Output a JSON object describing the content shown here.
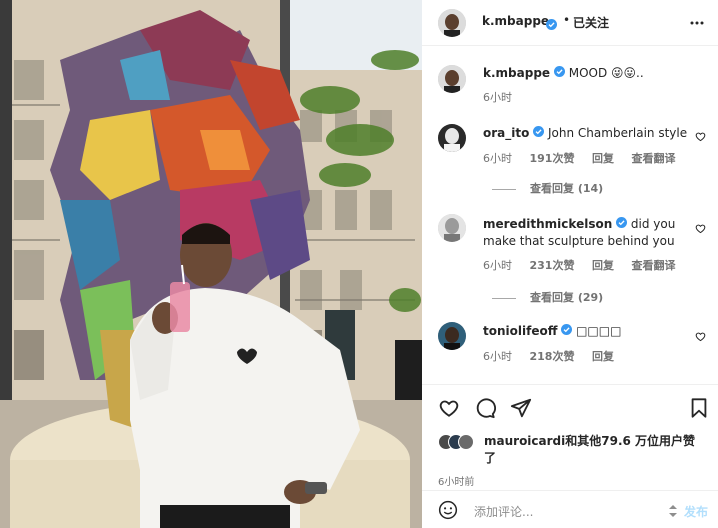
{
  "header": {
    "username": "k.mbappe",
    "separator": "•",
    "follow_status": "已关注",
    "more_icon": "more-horizontal-icon"
  },
  "caption": {
    "username": "k.mbappe",
    "text": "MOOD 😜😛..",
    "time": "6小时"
  },
  "comments": [
    {
      "username": "ora_ito",
      "verified": true,
      "text": "John Chamberlain style",
      "time": "6小时",
      "likes": "191次赞",
      "reply": "回复",
      "translate": "查看翻译",
      "view_replies": "查看回复 (14)"
    },
    {
      "username": "meredithmickelson",
      "verified": true,
      "text_line1": "did you",
      "text_line2": "make that sculpture behind you",
      "time": "6小时",
      "likes": "231次赞",
      "reply": "回复",
      "translate": "查看翻译",
      "view_replies": "查看回复 (29)"
    },
    {
      "username": "toniolifeoff",
      "verified": true,
      "text": "□□□□",
      "time": "6小时",
      "likes": "218次赞",
      "reply": "回复"
    }
  ],
  "actions": {
    "like_icon": "heart-icon",
    "comment_icon": "comment-icon",
    "share_icon": "send-icon",
    "save_icon": "bookmark-icon"
  },
  "likes": {
    "text_line1": "mauroicardi和其他79.6 万位用户赞",
    "text_line2": "了"
  },
  "post_time": "6小时前",
  "add_comment": {
    "placeholder": "添加评论...",
    "post_label": "发布"
  },
  "colors": {
    "verified": "#3897f0",
    "muted": "#737373",
    "post_disabled": "#b2dffc"
  }
}
